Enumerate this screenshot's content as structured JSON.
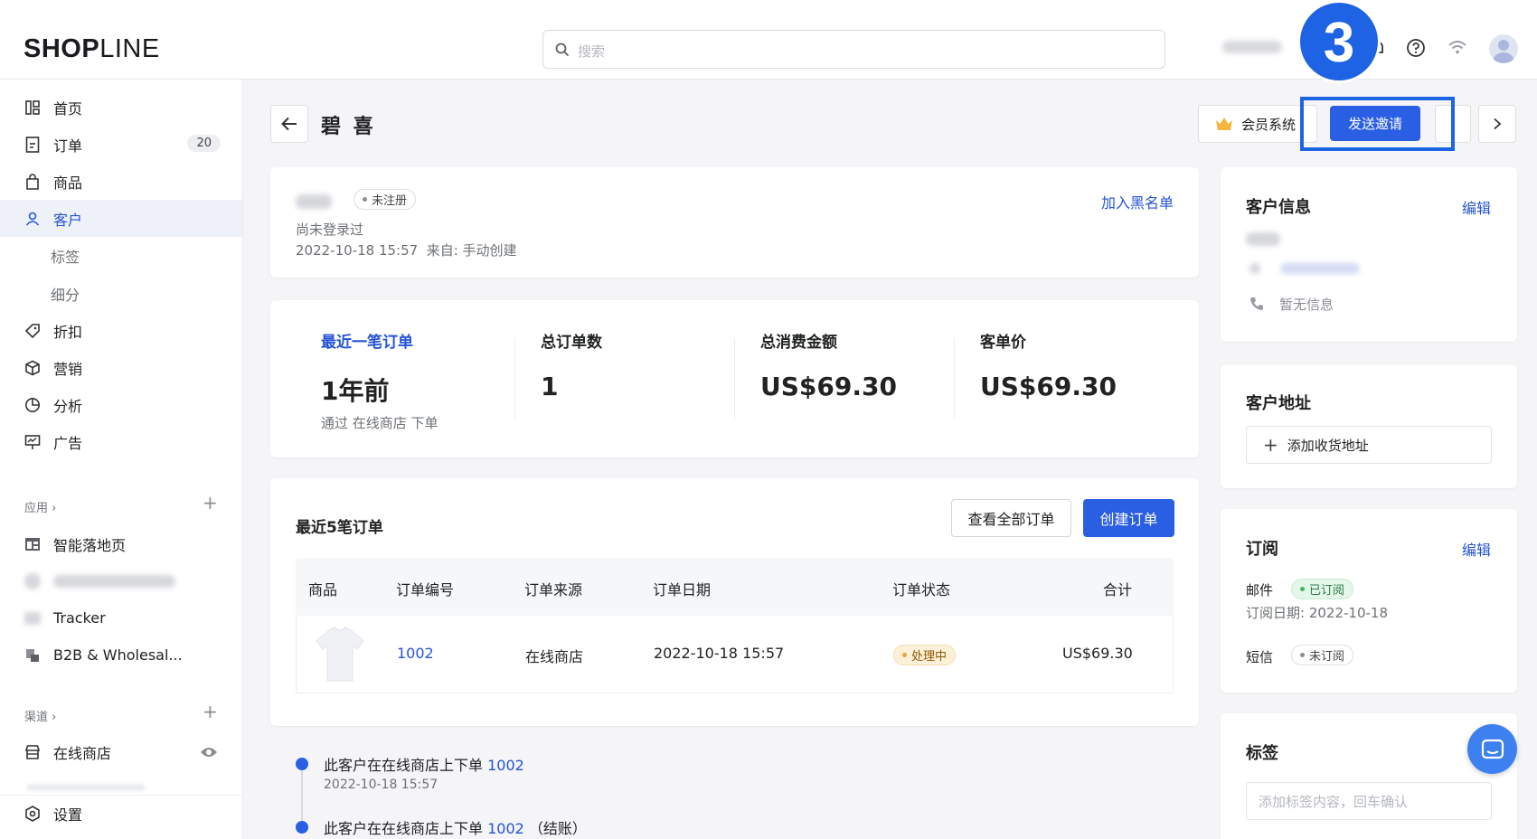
{
  "header": {
    "logo_main": "SHOP",
    "logo_rest": "LINE",
    "search_placeholder": "搜索",
    "step_number": "3"
  },
  "sidebar": {
    "items": [
      {
        "label": "首页"
      },
      {
        "label": "订单",
        "count": "20"
      },
      {
        "label": "商品"
      },
      {
        "label": "客户"
      },
      {
        "label": "标签"
      },
      {
        "label": "细分"
      },
      {
        "label": "折扣"
      },
      {
        "label": "营销"
      },
      {
        "label": "分析"
      },
      {
        "label": "广告"
      }
    ],
    "apps_label": "应用",
    "apps": [
      {
        "label": "智能落地页"
      },
      {
        "label": "Tracker"
      },
      {
        "label": "B2B & Wholesal..."
      }
    ],
    "channels_label": "渠道",
    "channels": [
      {
        "label": "在线商店"
      }
    ],
    "settings_label": "设置"
  },
  "page": {
    "title": "碧 喜",
    "membership_label": "会员系统",
    "invite_label": "发送邀请"
  },
  "customer_card": {
    "status": "未注册",
    "blacklist": "加入黑名单",
    "login_status": "尚未登录过",
    "created": "2022-10-18 15:57  来自: 手动创建"
  },
  "stats": [
    {
      "label": "最近一笔订单",
      "value": "1年前",
      "note": "通过 在线商店 下单"
    },
    {
      "label": "总订单数",
      "value": "1"
    },
    {
      "label": "总消费金额",
      "value": "US$69.30"
    },
    {
      "label": "客单价",
      "value": "US$69.30"
    }
  ],
  "orders": {
    "title": "最近5笔订单",
    "view_all": "查看全部订单",
    "create": "创建订单",
    "columns": [
      "商品",
      "订单编号",
      "订单来源",
      "订单日期",
      "订单状态",
      "合计"
    ],
    "rows": [
      {
        "number": "1002",
        "source": "在线商店",
        "date": "2022-10-18 15:57",
        "status": "处理中",
        "total": "US$69.30"
      }
    ]
  },
  "timeline": [
    {
      "text": "此客户在在线商店上下单",
      "link": "1002",
      "suffix": "",
      "time": "2022-10-18 15:57"
    },
    {
      "text": "此客户在在线商店上下单",
      "link": "1002",
      "suffix": "（结账）"
    }
  ],
  "right": {
    "customer_info": {
      "title": "客户信息",
      "edit": "编辑",
      "phone": "暂无信息"
    },
    "address": {
      "title": "客户地址",
      "add": "添加收货地址"
    },
    "subscription": {
      "title": "订阅",
      "edit": "编辑",
      "email_label": "邮件",
      "email_status": "已订阅",
      "date": "订阅日期: 2022-10-18",
      "sms_label": "短信",
      "sms_status": "未订阅"
    },
    "tags": {
      "title": "标签",
      "placeholder": "添加标签内容，回车确认"
    }
  },
  "colors": {
    "primary": "#2b5fe3",
    "highlight": "#1d63e3"
  }
}
